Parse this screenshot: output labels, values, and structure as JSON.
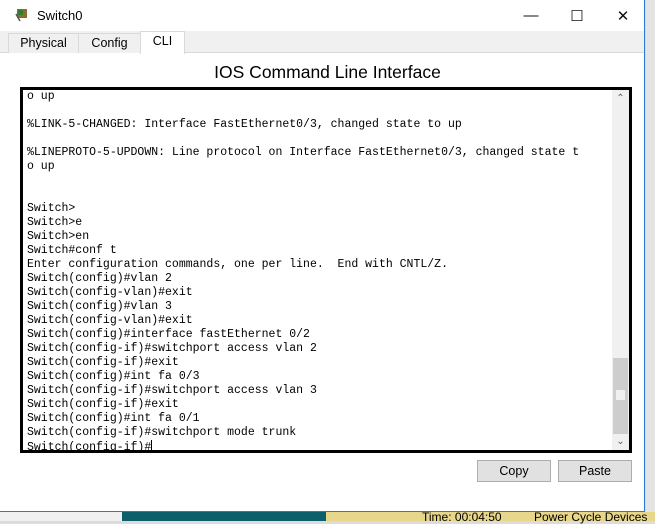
{
  "window": {
    "title": "Switch0",
    "controls": {
      "minimize": "—",
      "maximize": "☐",
      "close": "✕"
    }
  },
  "tabs": [
    {
      "label": "Physical",
      "active": false
    },
    {
      "label": "Config",
      "active": false
    },
    {
      "label": "CLI",
      "active": true
    }
  ],
  "cli": {
    "heading": "IOS Command Line Interface",
    "lines": [
      "o up",
      "",
      "%LINK-5-CHANGED: Interface FastEthernet0/3, changed state to up",
      "",
      "%LINEPROTO-5-UPDOWN: Line protocol on Interface FastEthernet0/3, changed state t",
      "o up",
      "",
      "",
      "Switch>",
      "Switch>e",
      "Switch>en",
      "Switch#conf t",
      "Enter configuration commands, one per line.  End with CNTL/Z.",
      "Switch(config)#vlan 2",
      "Switch(config-vlan)#exit",
      "Switch(config)#vlan 3",
      "Switch(config-vlan)#exit",
      "Switch(config)#interface fastEthernet 0/2",
      "Switch(config-if)#switchport access vlan 2",
      "Switch(config-if)#exit",
      "Switch(config)#int fa 0/3",
      "Switch(config-if)#switchport access vlan 3",
      "Switch(config-if)#exit",
      "Switch(config)#int fa 0/1",
      "Switch(config-if)#switchport mode trunk"
    ],
    "prompt": "Switch(config-if)#",
    "scroll_position_percent": 100
  },
  "buttons": {
    "copy": "Copy",
    "paste": "Paste"
  },
  "background_app": {
    "time": "Time: 00:04:50",
    "power_cycle": "Power Cycle Devices"
  }
}
